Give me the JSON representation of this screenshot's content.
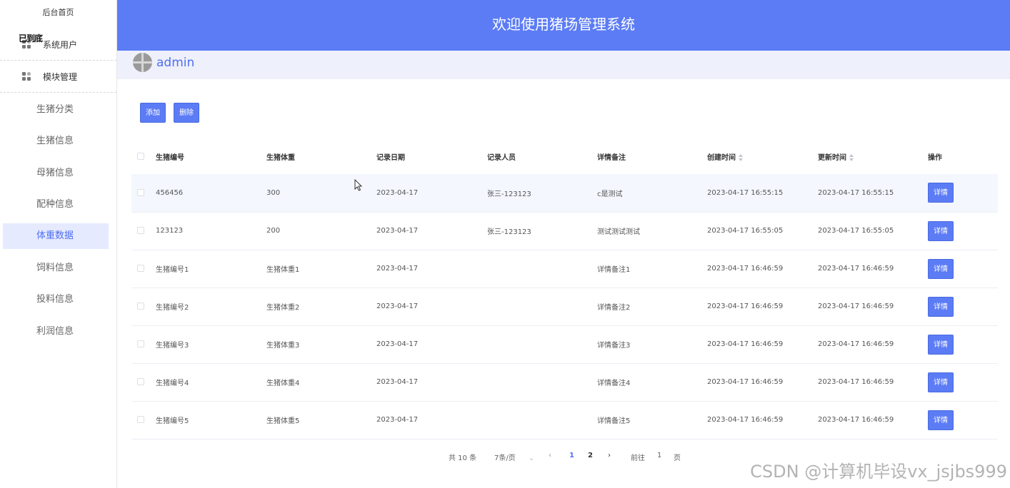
{
  "sidebar": {
    "home": "后台首页",
    "overlay": "已到底",
    "groups": [
      {
        "label": "系统用户"
      },
      {
        "label": "模块管理"
      }
    ],
    "items": [
      {
        "label": "生猪分类"
      },
      {
        "label": "生猪信息"
      },
      {
        "label": "母猪信息"
      },
      {
        "label": "配种信息"
      },
      {
        "label": "体重数据"
      },
      {
        "label": "饲料信息"
      },
      {
        "label": "投料信息"
      },
      {
        "label": "利润信息"
      }
    ],
    "active_item": "体重数据"
  },
  "header": {
    "title": "欢迎使用猪场管理系统"
  },
  "user": {
    "name": "admin"
  },
  "toolbar": {
    "add_label": "添加",
    "delete_label": "删除"
  },
  "table": {
    "columns": [
      "生猪编号",
      "生猪体重",
      "记录日期",
      "记录人员",
      "详情备注",
      "创建时间",
      "更新时间",
      "操作"
    ],
    "detail_label": "详情",
    "rows": [
      [
        "456456",
        "300",
        "2023-04-17",
        "张三-123123",
        "c是测试",
        "2023-04-17 16:55:15",
        "2023-04-17 16:55:15"
      ],
      [
        "123123",
        "200",
        "2023-04-17",
        "张三-123123",
        "测试测试测试",
        "2023-04-17 16:55:05",
        "2023-04-17 16:55:05"
      ],
      [
        "生猪编号1",
        "生猪体重1",
        "2023-04-17",
        "",
        "详情备注1",
        "2023-04-17 16:46:59",
        "2023-04-17 16:46:59"
      ],
      [
        "生猪编号2",
        "生猪体重2",
        "2023-04-17",
        "",
        "详情备注2",
        "2023-04-17 16:46:59",
        "2023-04-17 16:46:59"
      ],
      [
        "生猪编号3",
        "生猪体重3",
        "2023-04-17",
        "",
        "详情备注3",
        "2023-04-17 16:46:59",
        "2023-04-17 16:46:59"
      ],
      [
        "生猪编号4",
        "生猪体重4",
        "2023-04-17",
        "",
        "详情备注4",
        "2023-04-17 16:46:59",
        "2023-04-17 16:46:59"
      ],
      [
        "生猪编号5",
        "生猪体重5",
        "2023-04-17",
        "",
        "详情备注5",
        "2023-04-17 16:46:59",
        "2023-04-17 16:46:59"
      ]
    ]
  },
  "pagination": {
    "total": "共 10 条",
    "page_size": "7条/页",
    "pages": [
      "1",
      "2"
    ],
    "current_page": "1",
    "goto_label": "前往",
    "goto_value": "1",
    "page_unit": "页"
  },
  "watermark": "CSDN @计算机毕设vx_jsjbs999",
  "colors": {
    "primary": "#5c7cf5",
    "active_bg": "#e5eaff",
    "accent_text": "#4f6ef0"
  }
}
